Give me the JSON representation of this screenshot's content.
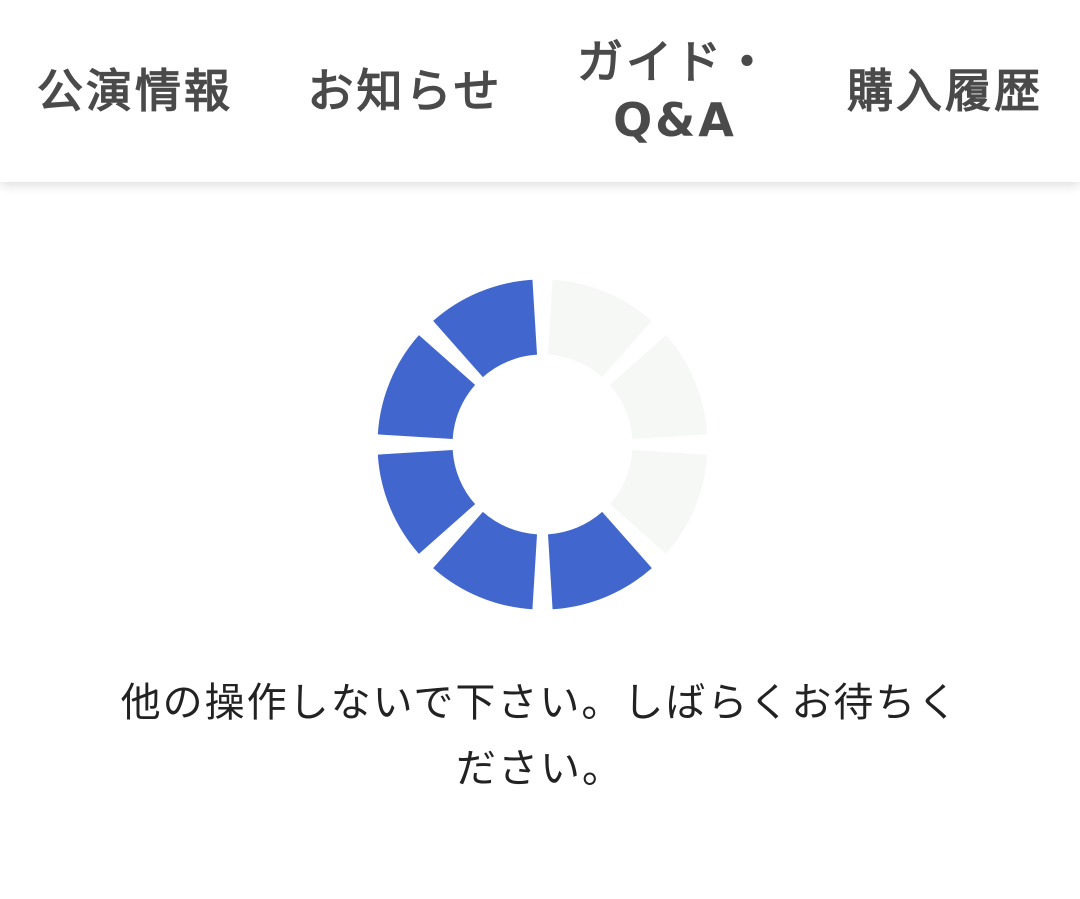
{
  "nav": {
    "items": [
      {
        "lines": [
          "公演情報"
        ]
      },
      {
        "lines": [
          "お知らせ"
        ]
      },
      {
        "lines": [
          "ガイド・",
          "Q&A"
        ]
      },
      {
        "lines": [
          "購入履歴"
        ]
      }
    ]
  },
  "loading": {
    "message_lines": [
      "他の操作しないで下さい。しばらくお待ちく",
      "ださい。"
    ]
  },
  "colors": {
    "spinner_active": "#4166cd",
    "spinner_inactive": "#f6f8f6",
    "nav_text": "#4a4a4a",
    "message_text": "#222222"
  }
}
